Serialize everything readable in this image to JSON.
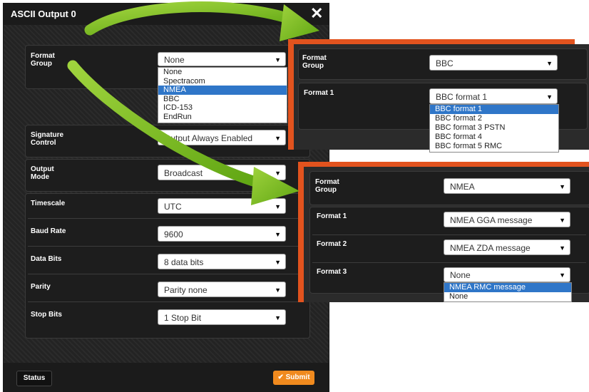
{
  "dialog": {
    "title": "ASCII Output 0",
    "close_icon": "close-icon",
    "format_group_label": "Format\nGroup",
    "format_group_value": "None",
    "format_group_options": [
      "None",
      "Spectracom",
      "NMEA",
      "BBC",
      "ICD-153",
      "EndRun"
    ],
    "format_group_highlight": "NMEA",
    "rows": [
      {
        "label": "Signature\nControl",
        "value": "Output Always Enabled"
      },
      {
        "label": "Output\nMode",
        "value": "Broadcast"
      },
      {
        "label": "Timescale",
        "value": "UTC"
      },
      {
        "label": "Baud Rate",
        "value": "9600"
      },
      {
        "label": "Data Bits",
        "value": "8 data bits"
      },
      {
        "label": "Parity",
        "value": "Parity none"
      },
      {
        "label": "Stop Bits",
        "value": "1 Stop Bit"
      }
    ],
    "status_label": "Status",
    "submit_label": "Submit",
    "submit_icon": "check-icon"
  },
  "bbc_panel": {
    "format_group_label": "Format\nGroup",
    "format_group_value": "BBC",
    "format1_label": "Format 1",
    "format1_value": "BBC format 1",
    "format1_options": [
      "BBC format 1",
      "BBC format 2",
      "BBC format 3 PSTN",
      "BBC format 4",
      "BBC format 5 RMC"
    ],
    "format1_highlight": "BBC format 1"
  },
  "nmea_panel": {
    "format_group_label": "Format\nGroup",
    "format_group_value": "NMEA",
    "format1_label": "Format 1",
    "format1_value": "NMEA GGA message",
    "format2_label": "Format 2",
    "format2_value": "NMEA ZDA message",
    "format3_label": "Format 3",
    "format3_value": "None",
    "format3_options": [
      "NMEA RMC message",
      "None"
    ],
    "format3_highlight": "NMEA RMC message"
  },
  "colors": {
    "accent_orange": "#e2531e",
    "arrow_green": "#7cc11f",
    "highlight_blue": "#2f76c8",
    "submit_orange": "#f08a1e"
  }
}
